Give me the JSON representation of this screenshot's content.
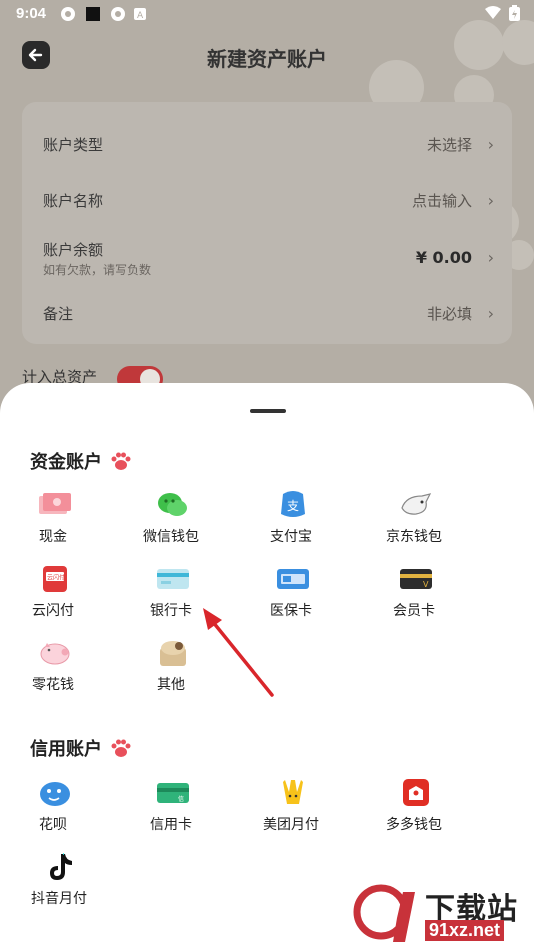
{
  "status_bar": {
    "time": "9:04"
  },
  "header": {
    "title": "新建资产账户"
  },
  "form": {
    "rows": [
      {
        "label": "账户类型",
        "value": "未选择"
      },
      {
        "label": "账户名称",
        "value": "点击输入"
      },
      {
        "label": "账户余额",
        "sublabel": "如有欠款，请写负数",
        "value": "¥ 0.00"
      },
      {
        "label": "备注",
        "value": "非必填"
      }
    ],
    "total_label": "计入总资产",
    "toggle_on": true
  },
  "sheet": {
    "funds": {
      "title": "资金账户",
      "items": [
        {
          "label": "现金",
          "icon": "cash-icon"
        },
        {
          "label": "微信钱包",
          "icon": "wechat-icon"
        },
        {
          "label": "支付宝",
          "icon": "alipay-icon"
        },
        {
          "label": "京东钱包",
          "icon": "jd-icon"
        },
        {
          "label": "云闪付",
          "icon": "unionpay-icon"
        },
        {
          "label": "银行卡",
          "icon": "bank-card-icon"
        },
        {
          "label": "医保卡",
          "icon": "medical-card-icon"
        },
        {
          "label": "会员卡",
          "icon": "member-card-icon"
        },
        {
          "label": "零花钱",
          "icon": "piggy-bank-icon"
        },
        {
          "label": "其他",
          "icon": "other-icon"
        }
      ]
    },
    "credit": {
      "title": "信用账户",
      "items": [
        {
          "label": "花呗",
          "icon": "huabei-icon"
        },
        {
          "label": "信用卡",
          "icon": "credit-card-icon"
        },
        {
          "label": "美团月付",
          "icon": "meituan-icon"
        },
        {
          "label": "多多钱包",
          "icon": "pinduoduo-icon"
        },
        {
          "label": "抖音月付",
          "icon": "douyin-icon"
        }
      ]
    }
  },
  "watermark": {
    "text": "下载站",
    "url": "91xz.net"
  },
  "colors": {
    "accent": "#c0383a",
    "paw": "#e8505b",
    "overlay": "#b4aea5"
  }
}
